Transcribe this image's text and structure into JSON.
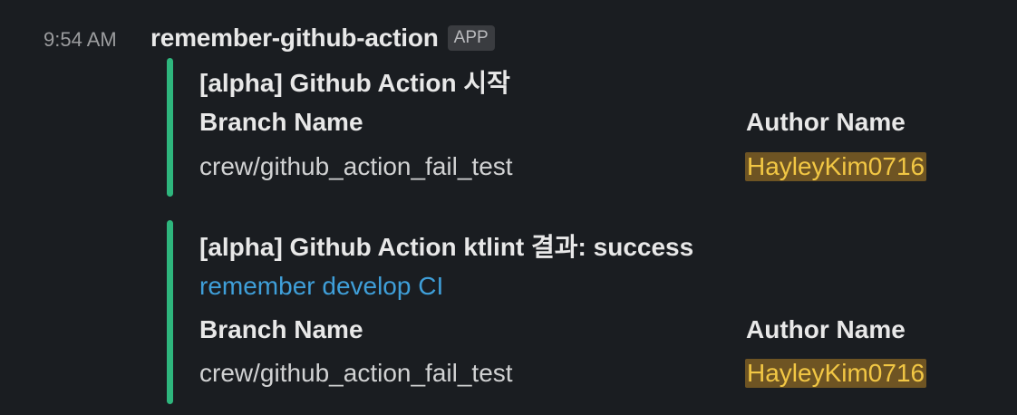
{
  "message": {
    "time": "9:54 AM",
    "sender": "remember-github-action",
    "badge": "APP"
  },
  "colors": {
    "attachment_bar": "#2eb67d",
    "link": "#3f9fd9",
    "mention_bg": "#6e5423",
    "mention_text": "#f2c744"
  },
  "attachments": [
    {
      "title": "[alpha] Github Action 시작",
      "fields": [
        {
          "label": "Branch Name",
          "value": "crew/github_action_fail_test"
        },
        {
          "label": "Author Name",
          "value": "HayleyKim0716"
        }
      ]
    },
    {
      "title": "[alpha] Github Action ktlint 결과: success",
      "link": "remember develop CI",
      "fields": [
        {
          "label": "Branch Name",
          "value": "crew/github_action_fail_test"
        },
        {
          "label": "Author Name",
          "value": "HayleyKim0716"
        }
      ]
    }
  ]
}
